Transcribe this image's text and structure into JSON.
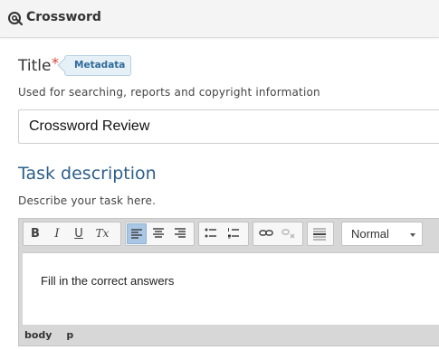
{
  "header": {
    "title": "Crossword",
    "icon": "crossword-app-icon"
  },
  "title_field": {
    "label": "Title",
    "required_mark": "*",
    "badge": "Metadata",
    "help": "Used for searching, reports and copyright information",
    "value": "Crossword Review"
  },
  "task_description": {
    "heading": "Task description",
    "help": "Describe your task here."
  },
  "editor": {
    "toolbar": {
      "bold": "B",
      "italic": "I",
      "underline": "U",
      "remove_format": "Tx",
      "format_value": "Normal",
      "active_button": "align-left"
    },
    "content": "Fill in the correct answers",
    "path": [
      "body",
      "p"
    ]
  },
  "colors": {
    "accent": "#2e5f8a",
    "required": "#d9443c",
    "active_button": "#a9c7e5"
  }
}
